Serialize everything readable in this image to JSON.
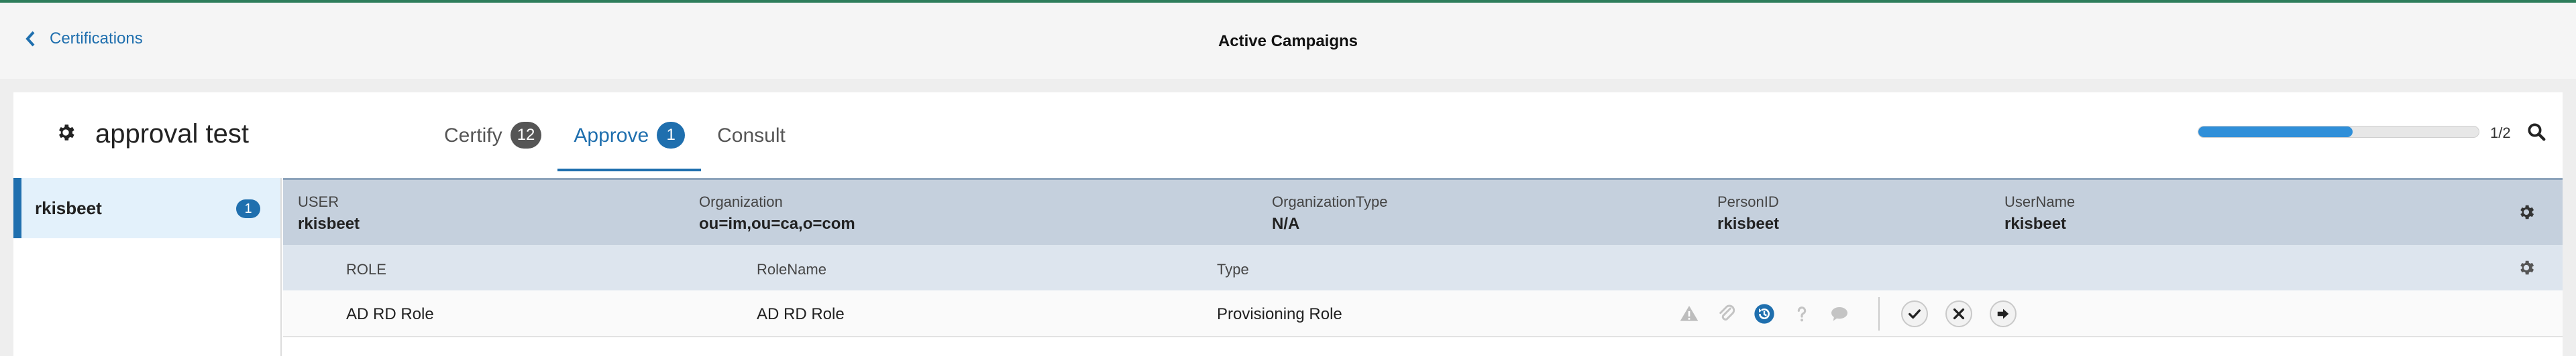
{
  "topbar": {
    "back_label": "Certifications",
    "title": "Active Campaigns"
  },
  "campaign": {
    "title": "approval test",
    "tabs": [
      {
        "label": "Certify",
        "count": "12"
      },
      {
        "label": "Approve",
        "count": "1"
      },
      {
        "label": "Consult"
      }
    ],
    "active_tab": "Approve",
    "progress_fraction": 0.55,
    "page_indicator": "1/2"
  },
  "sidebar": {
    "items": [
      {
        "name": "rkisbeet",
        "count": "1"
      }
    ]
  },
  "user_row": {
    "fields": [
      {
        "label": "USER",
        "value": "rkisbeet"
      },
      {
        "label": "Organization",
        "value": "ou=im,ou=ca,o=com"
      },
      {
        "label": "OrganizationType",
        "value": "N/A"
      },
      {
        "label": "PersonID",
        "value": "rkisbeet"
      },
      {
        "label": "UserName",
        "value": "rkisbeet"
      }
    ]
  },
  "roles": {
    "headers": [
      "ROLE",
      "RoleName",
      "Type"
    ],
    "rows": [
      {
        "role": "AD RD Role",
        "role_name": "AD RD Role",
        "type": "Provisioning Role"
      }
    ]
  },
  "icons": {
    "status": [
      "warning-icon",
      "attachment-icon",
      "history-icon",
      "help-icon",
      "comment-icon"
    ],
    "actions": [
      "approve-check-icon",
      "reject-x-icon",
      "forward-arrow-icon"
    ]
  },
  "colors": {
    "accent": "#1f6fae",
    "progress": "#2f8fd9",
    "user_row_bg": "#c5d0dd",
    "topbar_accent": "#2e7d5b"
  }
}
